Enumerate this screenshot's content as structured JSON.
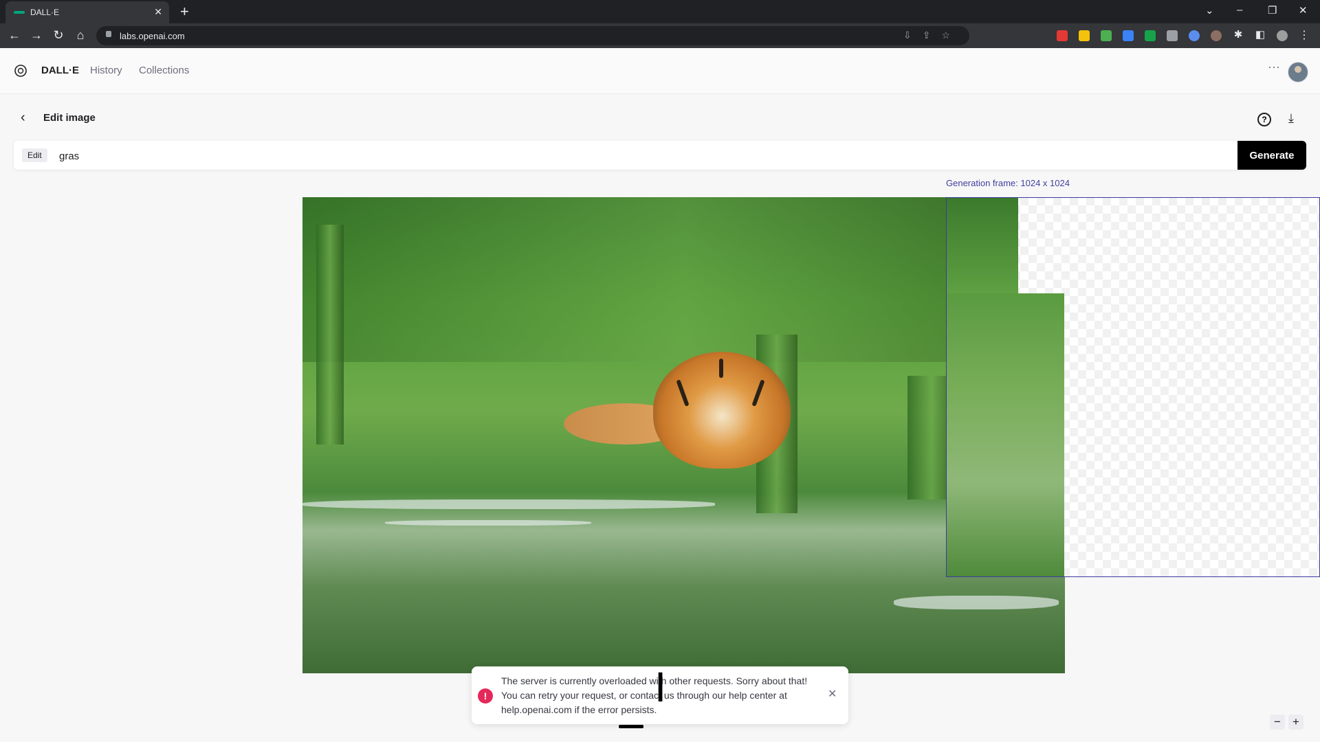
{
  "browser": {
    "tab_title": "DALL·E",
    "url": "labs.openai.com"
  },
  "app": {
    "brand": "DALL·E",
    "nav": [
      "History",
      "Collections"
    ]
  },
  "editor": {
    "title": "Edit image",
    "badge": "Edit",
    "prompt_value": "gras",
    "generate_label": "Generate",
    "frame_label": "Generation frame: 1024 x 1024"
  },
  "toast": {
    "message": "The server is currently overloaded with other requests. Sorry about that! You can retry your request, or contact us through our help center at help.openai.com if the error persists."
  },
  "colors": {
    "accent": "#000000",
    "error": "#e5285a",
    "frame": "#3a3aa0"
  }
}
